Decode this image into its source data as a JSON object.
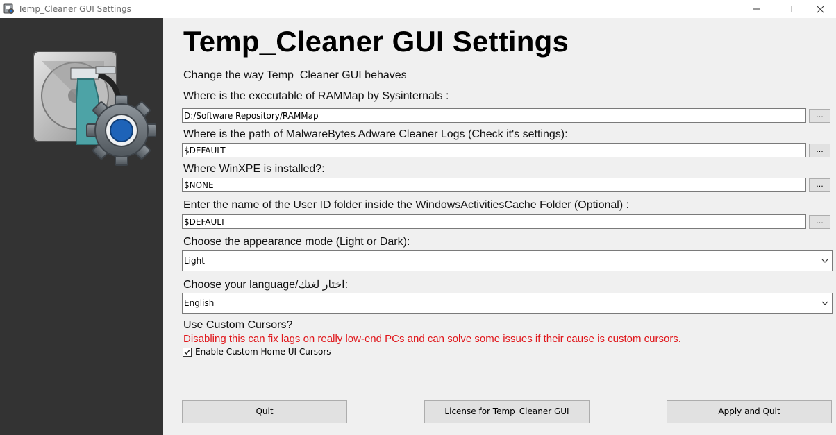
{
  "window": {
    "title": "Temp_Cleaner GUI Settings"
  },
  "main": {
    "heading": "Temp_Cleaner GUI Settings",
    "subtitle": "Change the way Temp_Cleaner GUI behaves",
    "rammap": {
      "label": "Where is the executable of RAMMap by Sysinternals :",
      "value": "D:/Software Repository/RAMMap",
      "browse_label": "..."
    },
    "adwcleaner": {
      "label": "Where is the path of MalwareBytes Adware Cleaner Logs (Check it's settings):",
      "value": "$DEFAULT",
      "browse_label": "..."
    },
    "winxpe": {
      "label": "Where WinXPE is installed?:",
      "value": "$NONE",
      "browse_label": "..."
    },
    "userid": {
      "label": "Enter the name of the User ID folder inside the WindowsActivitiesCache Folder (Optional) :",
      "value": "$DEFAULT",
      "browse_label": "..."
    },
    "appearance": {
      "label": "Choose the appearance mode (Light or Dark):",
      "selected": "Light"
    },
    "language": {
      "label": "Choose your language/اختار لغتك:",
      "selected": "English"
    },
    "cursors": {
      "label": "Use Custom Cursors?",
      "warning": "Disabling this can fix lags on really low-end PCs and can solve some issues if their cause is custom cursors.",
      "checkbox_label": "Enable Custom Home UI Cursors",
      "checked": true
    }
  },
  "buttons": {
    "quit": "Quit",
    "license": "License for Temp_Cleaner GUI",
    "apply": "Apply and Quit"
  },
  "colors": {
    "side_panel": "#333333",
    "content_bg": "#f0f0f0",
    "warning_text": "#e0161b"
  }
}
